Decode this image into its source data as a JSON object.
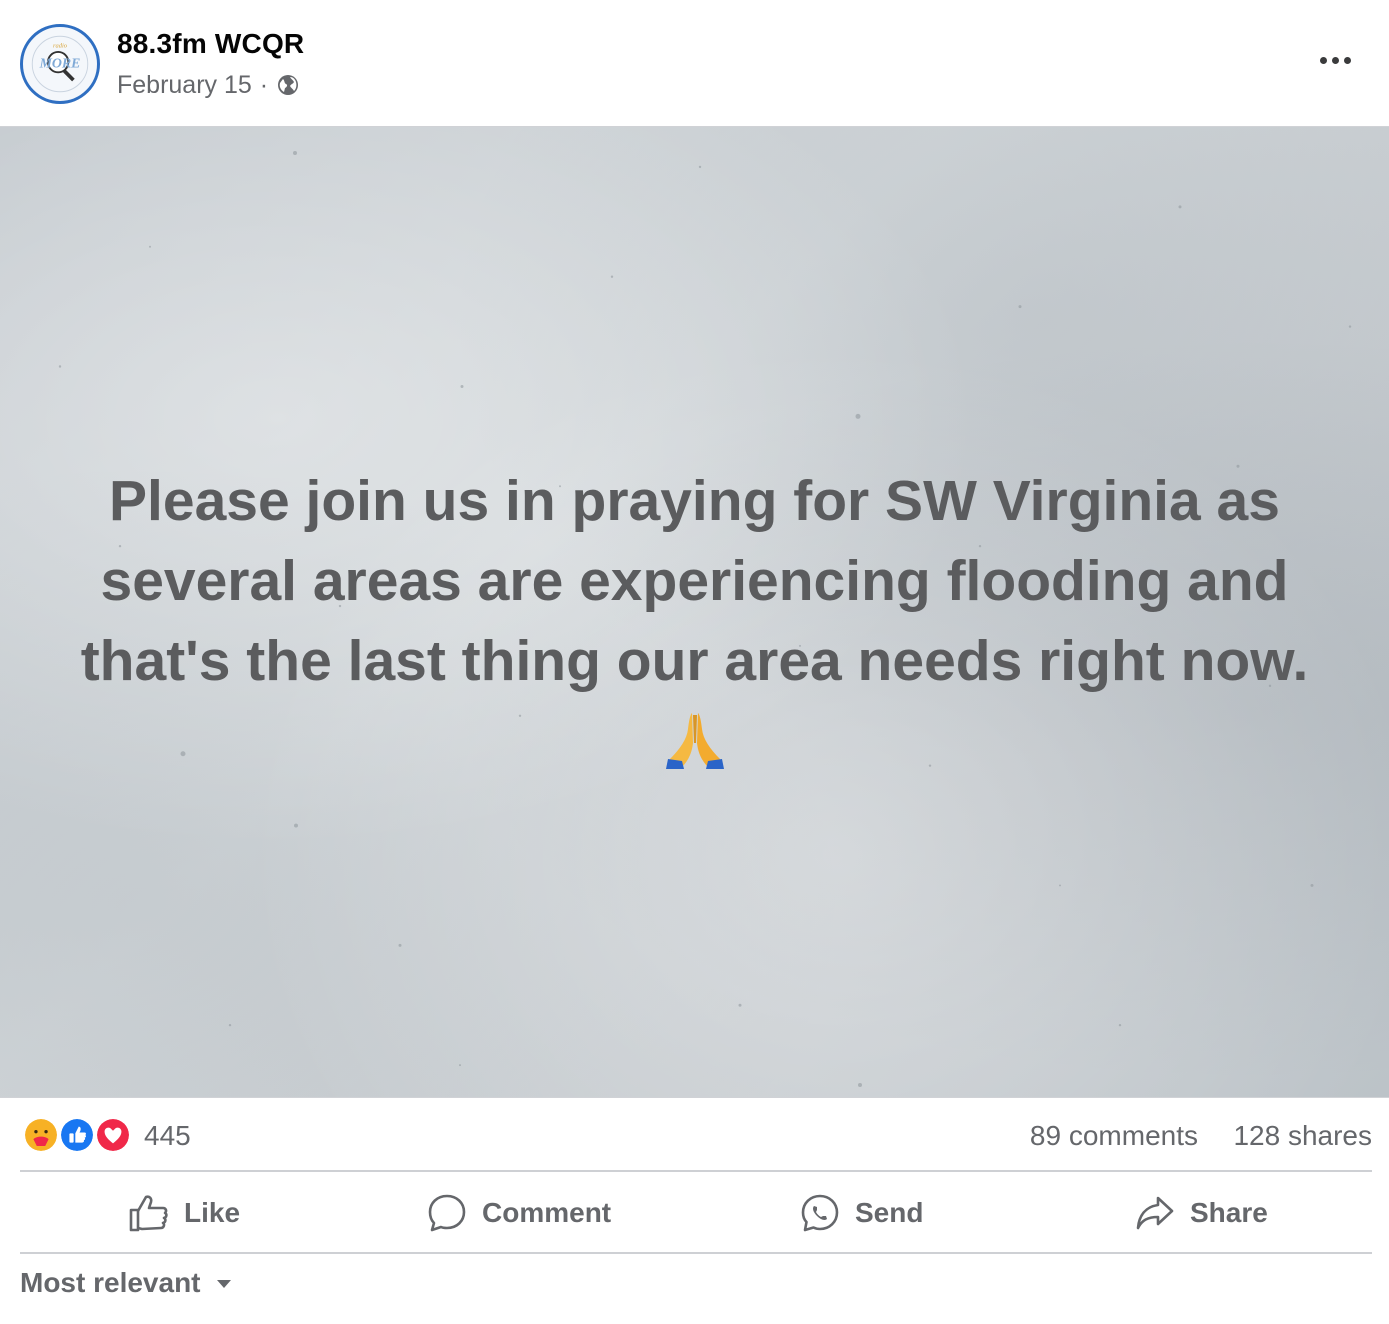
{
  "post": {
    "page_name": "88.3fm WCQR",
    "date": "February 15",
    "separator": "·",
    "privacy_icon": "globe-icon",
    "more_icon": "more-options-icon",
    "avatar_text": "MORE"
  },
  "image": {
    "text": "Please join us in praying for SW Virginia as several areas are experiencing flooding and that's the last thing our area needs right now.",
    "emoji": "praying-hands-emoji"
  },
  "reactions": {
    "icons": [
      "care-icon",
      "like-icon",
      "love-icon"
    ],
    "count": "445",
    "comments": "89 comments",
    "shares": "128 shares"
  },
  "actions": {
    "like": "Like",
    "comment": "Comment",
    "send": "Send",
    "share": "Share"
  },
  "sort": {
    "label": "Most relevant"
  },
  "colors": {
    "secondary_text": "#65676b",
    "like_blue": "#1877f2",
    "love_red": "#f02849",
    "care_yellow": "#f7b125"
  }
}
